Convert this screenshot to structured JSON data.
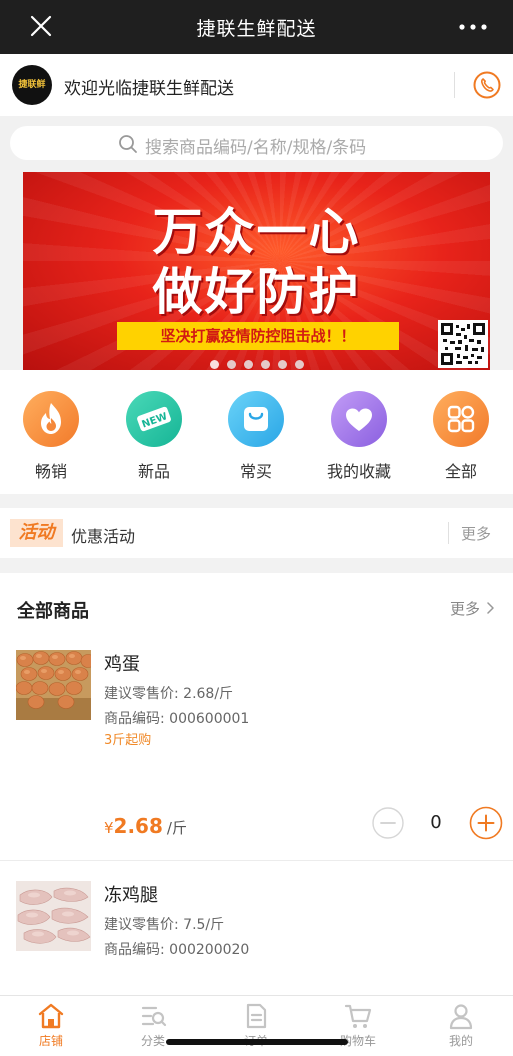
{
  "titlebar": {
    "title": "捷联生鲜配送",
    "close_icon": "close-icon",
    "more_icon": "more-dots-icon"
  },
  "store": {
    "welcome": "欢迎光临捷联生鲜配送",
    "logo_text": "捷联鲜",
    "phone_icon": "phone-icon"
  },
  "search": {
    "placeholder": "搜索商品编码/名称/规格/条码"
  },
  "banner": {
    "line1": "万众一心",
    "line2": "做好防护",
    "slogan": "坚决打赢疫情防控阻击战！！",
    "dots": 6,
    "active_dot": 0
  },
  "categories": [
    {
      "label": "畅销",
      "icon": "flame-icon",
      "color": "#f5883a"
    },
    {
      "label": "新品",
      "icon": "new-tag-icon",
      "color": "#27c4a6"
    },
    {
      "label": "常买",
      "icon": "shopping-bag-icon",
      "color": "#39b7ec"
    },
    {
      "label": "我的收藏",
      "icon": "heart-icon",
      "color": "#a47be8"
    },
    {
      "label": "全部",
      "icon": "grid-icon",
      "color": "#f5883a"
    }
  ],
  "activity": {
    "badge": "活动",
    "title": "优惠活动",
    "more": "更多"
  },
  "products": {
    "title": "全部商品",
    "more": "更多",
    "items": [
      {
        "name": "鸡蛋",
        "retail": "建议零售价: 2.68/斤",
        "code": "商品编码: 000600001",
        "minbuy": "3斤起购",
        "currency": "¥",
        "price": "2.68",
        "unit": "/斤",
        "qty": "0"
      },
      {
        "name": "冻鸡腿",
        "retail": "建议零售价: 7.5/斤",
        "code": "商品编码: 000200020"
      }
    ]
  },
  "tabs": [
    {
      "label": "店铺",
      "icon": "home-icon",
      "active": true
    },
    {
      "label": "分类",
      "icon": "category-icon",
      "active": false
    },
    {
      "label": "订单",
      "icon": "order-icon",
      "active": false
    },
    {
      "label": "购物车",
      "icon": "cart-icon",
      "active": false
    },
    {
      "label": "我的",
      "icon": "user-icon",
      "active": false
    }
  ],
  "colors": {
    "accent": "#f07a22",
    "banner_red": "#e8231a",
    "slogan_yellow": "#ffd200"
  }
}
